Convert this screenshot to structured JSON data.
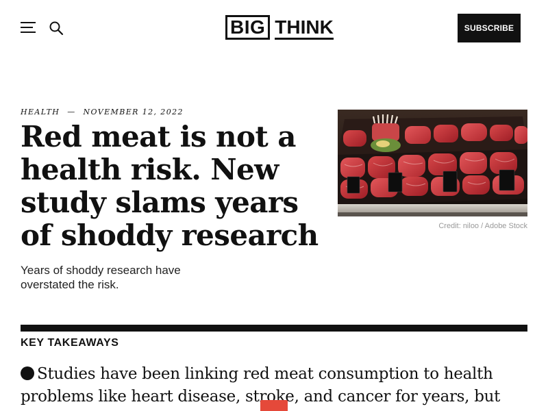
{
  "header": {
    "logo_big": "BIG",
    "logo_think": "THINK",
    "subscribe_label": "SUBSCRIBE",
    "menu_icon": "hamburger-menu-icon",
    "search_icon": "search-icon"
  },
  "article": {
    "category": "Health",
    "separator": "—",
    "date": "November 12, 2022",
    "headline": "Red meat is not a health risk. New study slams years of shoddy research",
    "dek": "Years of shoddy research have overstated the risk.",
    "image": {
      "description_icon": "meat-display-photo",
      "credit": "Credit: niloo / Adobe Stock"
    }
  },
  "takeaways": {
    "title": "KEY TAKEAWAYS",
    "items": [
      "Studies have been linking red meat consumption to health problems like heart disease, stroke, and cancer for years, but"
    ]
  },
  "colors": {
    "text": "#111111",
    "accent": "#e5493a",
    "muted": "#999999"
  }
}
